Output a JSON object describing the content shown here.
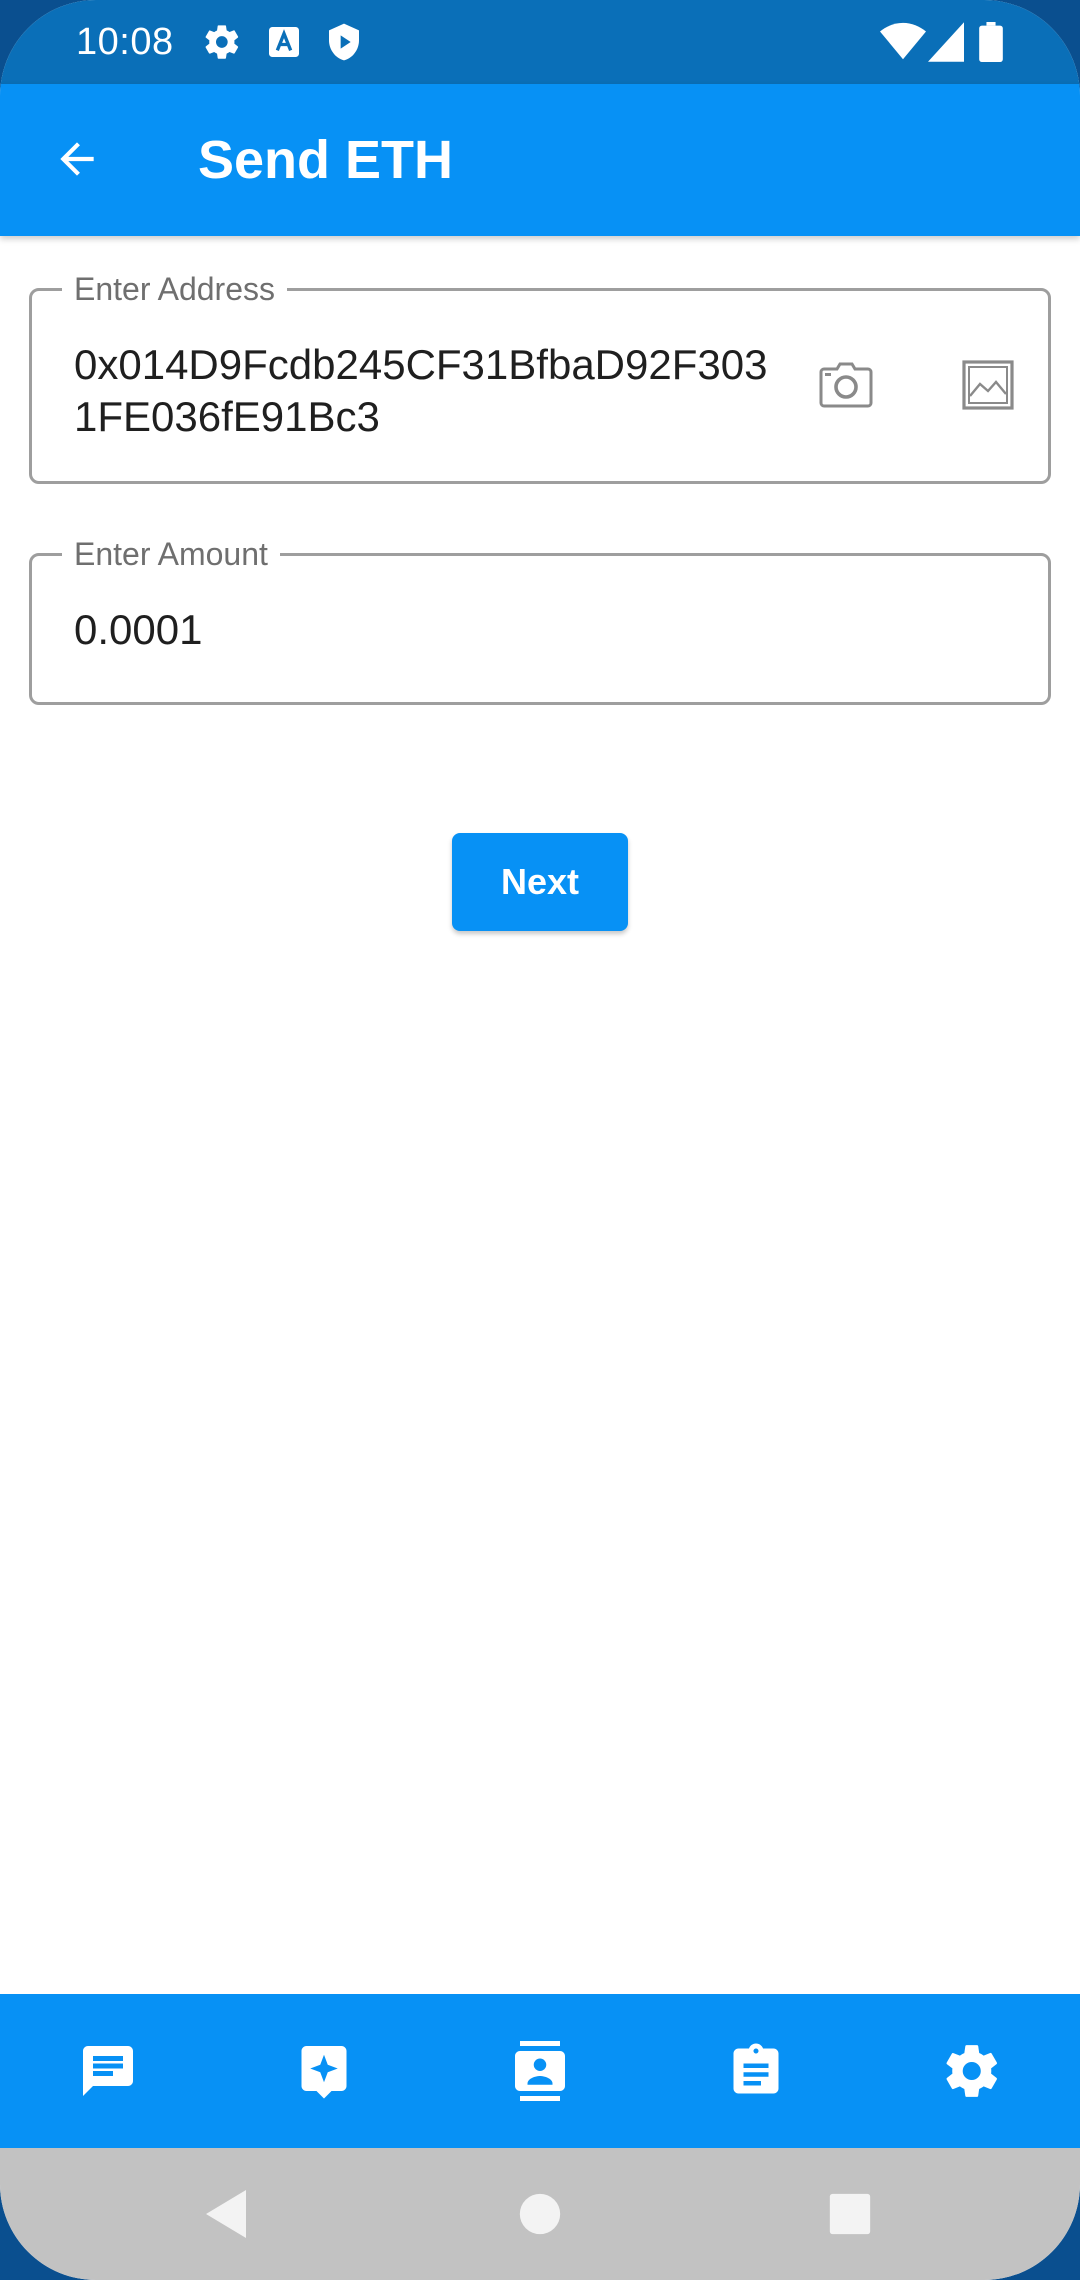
{
  "status_bar": {
    "time": "10:08",
    "left_icons": [
      "gear-icon",
      "font-icon",
      "shield-icon"
    ],
    "right_icons": [
      "wifi-icon",
      "signal-icon",
      "battery-icon"
    ]
  },
  "app_bar": {
    "title": "Send ETH",
    "back_icon": "arrow-left-icon"
  },
  "form": {
    "address": {
      "label": "Enter Address",
      "value": "0x014D9Fcdb245CF31BfbaD92F3031FE036fE91Bc3",
      "icons": [
        "camera-icon",
        "image-icon"
      ]
    },
    "amount": {
      "label": "Enter Amount",
      "value": "0.0001"
    },
    "next_label": "Next"
  },
  "bottom_nav": {
    "items": [
      "chat-icon",
      "sparkle-icon",
      "contact-icon",
      "clipboard-icon",
      "settings-icon"
    ]
  },
  "system_nav": {
    "items": [
      "back-triangle-icon",
      "home-circle-icon",
      "recents-square-icon"
    ]
  },
  "colors": {
    "status_bar": "#0a6fb8",
    "primary": "#0791f5",
    "system_nav": "#c2c2c2",
    "field_border": "#9e9e9e"
  }
}
